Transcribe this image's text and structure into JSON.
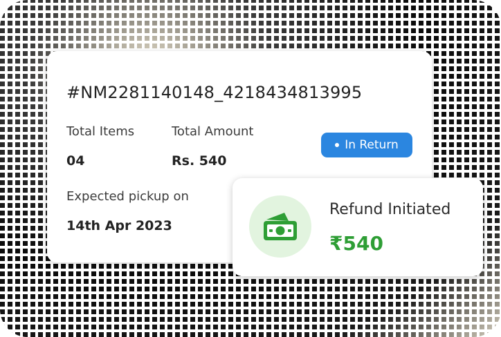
{
  "order": {
    "id": "#NM2281140148_4218434813995",
    "total_items_label": "Total Items",
    "total_items_value": "04",
    "total_amount_label": "Total Amount",
    "total_amount_value": "Rs. 540",
    "status": "In Return",
    "pickup_label": "Expected pickup on",
    "pickup_date": "14th Apr 2023"
  },
  "refund": {
    "title": "Refund Initiated",
    "amount": "₹540",
    "icon": "cash-icon"
  },
  "colors": {
    "status_badge": "#2b86e0",
    "refund_amount": "#2e9e35",
    "refund_icon_bg": "#e2f4df"
  }
}
